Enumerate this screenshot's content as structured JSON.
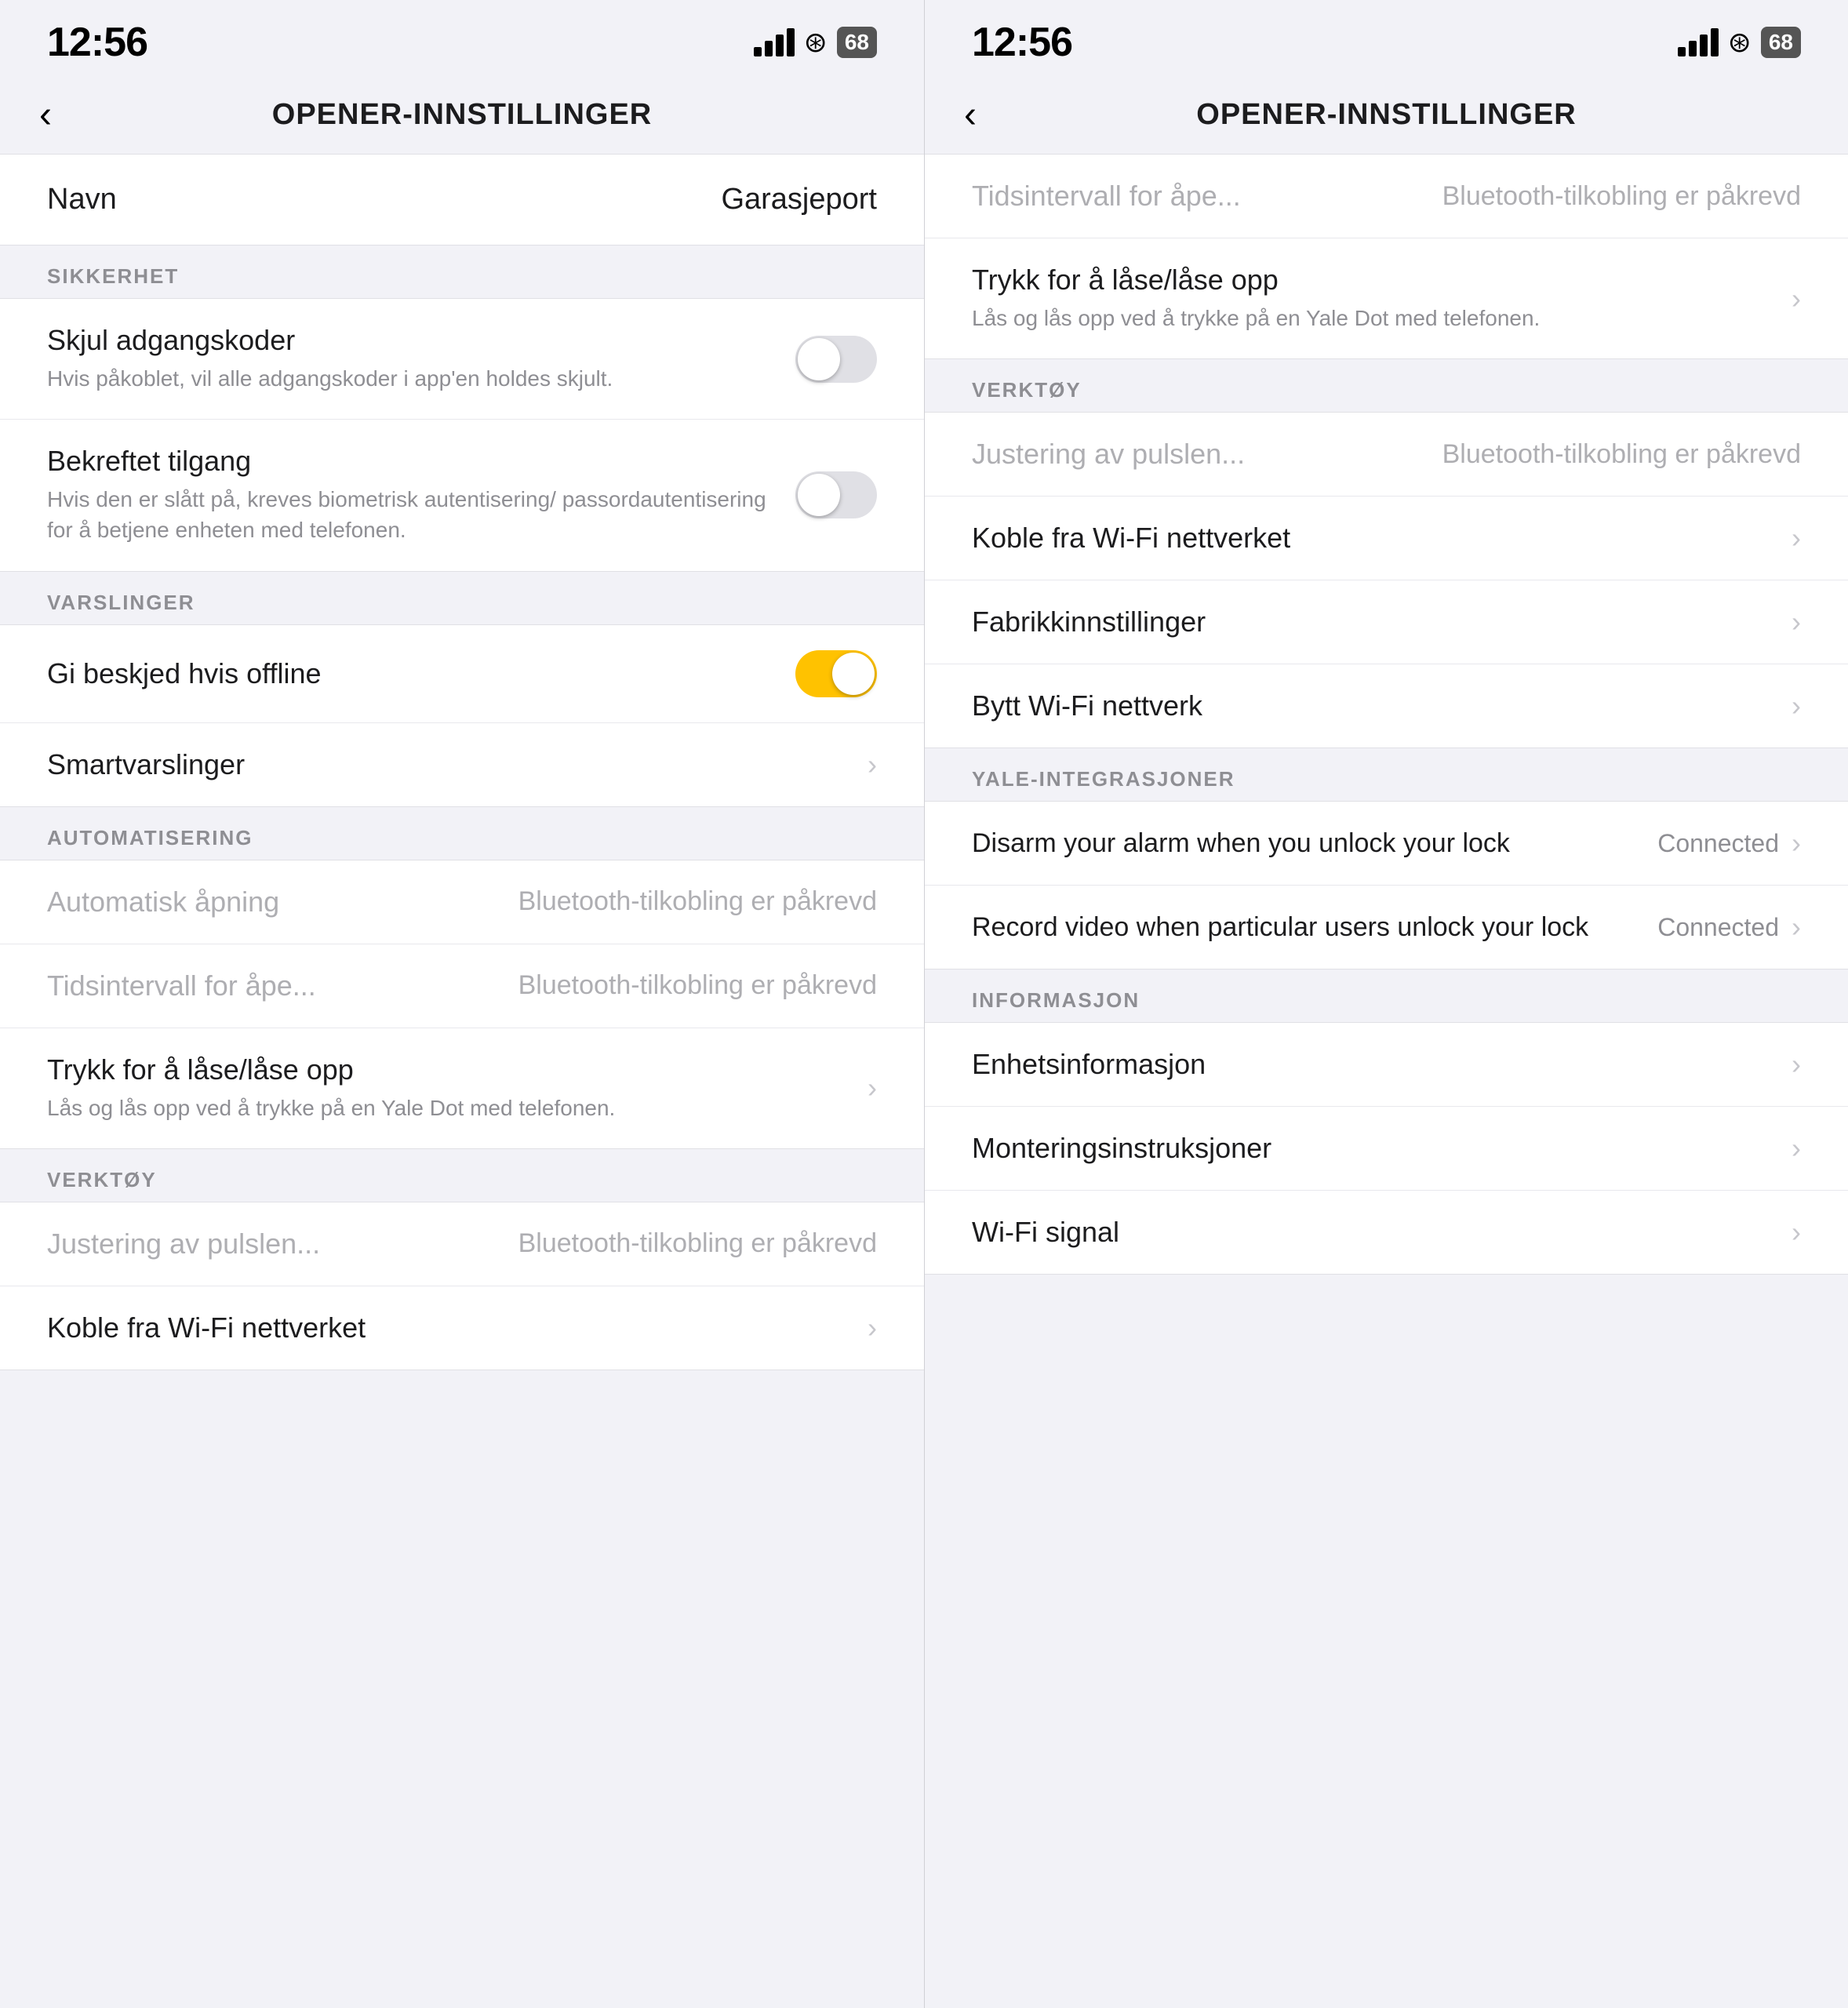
{
  "panel_left": {
    "status": {
      "time": "12:56",
      "battery": "68"
    },
    "nav": {
      "back_label": "<",
      "title": "OPENER-INNSTILLINGER"
    },
    "name_row": {
      "label": "Navn",
      "value": "Garasjeport"
    },
    "sections": [
      {
        "id": "sikkerhet",
        "header": "SIKKERHET",
        "items": [
          {
            "id": "skjul-adgangskoder",
            "title": "Skjul adgangskoder",
            "subtitle": "Hvis påkoblet, vil alle adgangskoder i app'en holdes skjult.",
            "type": "toggle",
            "toggle_state": "off"
          },
          {
            "id": "bekreftet-tilgang",
            "title": "Bekreftet tilgang",
            "subtitle": "Hvis den er slått på, kreves biometrisk autentisering/ passordautentisering\nfor å betjene enheten med telefonen.",
            "type": "toggle",
            "toggle_state": "off"
          }
        ]
      },
      {
        "id": "varslinger",
        "header": "VARSLINGER",
        "items": [
          {
            "id": "gi-beskjed",
            "title": "Gi beskjed hvis offline",
            "type": "toggle",
            "toggle_state": "on"
          },
          {
            "id": "smartvarslinger",
            "title": "Smartvarslinger",
            "type": "chevron"
          }
        ]
      },
      {
        "id": "automatisering",
        "header": "AUTOMATISERING",
        "items": [
          {
            "id": "automatisk-apning",
            "title": "Automatisk åpning",
            "value": "Bluetooth-tilkobling er påkrevd",
            "type": "disabled"
          },
          {
            "id": "tidsintervall",
            "title": "Tidsintervall for åpe...",
            "value": "Bluetooth-tilkobling er påkrevd",
            "type": "disabled"
          },
          {
            "id": "trykk-for-lase",
            "title": "Trykk for å låse/låse opp",
            "subtitle": "Lås og lås opp ved å trykke på en Yale Dot med telefonen.",
            "type": "chevron"
          }
        ]
      },
      {
        "id": "verktoy",
        "header": "VERKTØY",
        "items": [
          {
            "id": "justering-puls",
            "title": "Justering av pulslen...",
            "value": "Bluetooth-tilkobling er påkrevd",
            "type": "disabled"
          },
          {
            "id": "koble-fra-wifi",
            "title": "Koble fra Wi-Fi nettverket",
            "type": "chevron-partial"
          }
        ]
      }
    ]
  },
  "panel_right": {
    "status": {
      "time": "12:56",
      "battery": "68"
    },
    "nav": {
      "back_label": "<",
      "title": "OPENER-INNSTILLINGER"
    },
    "top_scroll_items": [
      {
        "id": "tidsintervall-top",
        "title": "Tidsintervall for åpe...",
        "value": "Bluetooth-tilkobling er påkrevd",
        "type": "disabled"
      },
      {
        "id": "trykk-lase-top",
        "title": "Trykk for å låse/låse opp",
        "subtitle": "Lås og lås opp ved å trykke på en Yale Dot med telefonen.",
        "type": "chevron"
      }
    ],
    "sections": [
      {
        "id": "verktoy",
        "header": "VERKTØY",
        "items": [
          {
            "id": "justering-puls-r",
            "title": "Justering av pulslen...",
            "value": "Bluetooth-tilkobling er påkrevd",
            "type": "disabled"
          },
          {
            "id": "koble-fra-wifi-r",
            "title": "Koble fra Wi-Fi nettverket",
            "type": "chevron"
          },
          {
            "id": "fabrikkinnstillinger",
            "title": "Fabrikkinnstillinger",
            "type": "chevron"
          },
          {
            "id": "bytt-wifi",
            "title": "Bytt Wi-Fi nettverk",
            "type": "chevron"
          }
        ]
      },
      {
        "id": "yale-integrasjoner",
        "header": "YALE-INTEGRASJONER",
        "items": [
          {
            "id": "disarm-alarm",
            "title": "Disarm your alarm when you unlock your lock",
            "value": "Connected",
            "type": "chevron-value"
          },
          {
            "id": "record-video",
            "title": "Record video when particular users unlock your lock",
            "value": "Connected",
            "type": "chevron-value"
          }
        ]
      },
      {
        "id": "informasjon",
        "header": "INFORMASJON",
        "items": [
          {
            "id": "enhetsinformasjon",
            "title": "Enhetsinformasjon",
            "type": "chevron"
          },
          {
            "id": "monteringsinstruksjoner",
            "title": "Monteringsinstruksjoner",
            "type": "chevron"
          },
          {
            "id": "wifi-signal",
            "title": "Wi-Fi signal",
            "type": "chevron"
          }
        ]
      }
    ]
  },
  "icons": {
    "chevron": "›",
    "back": "‹"
  }
}
